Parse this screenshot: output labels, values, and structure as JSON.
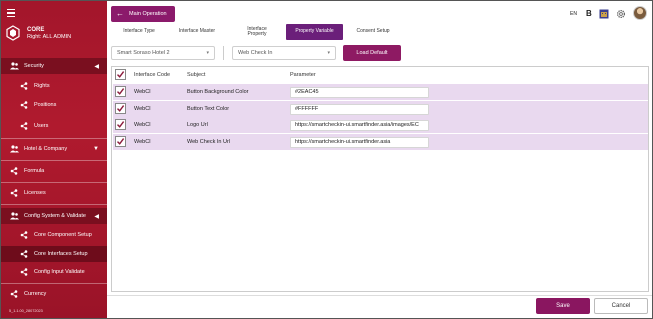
{
  "colors": {
    "sidebar": "#a3162b",
    "accent": "#6b1f7a",
    "row_highlight": "#e9d9ef",
    "button": "#8a1660"
  },
  "brand": {
    "name": "CORE",
    "right": "Right: ALL ADMIN"
  },
  "sidebar": {
    "items": [
      {
        "label": "Security",
        "icon": "people-icon",
        "chevron": "◀"
      },
      {
        "label": "Rights",
        "icon": "share-icon"
      },
      {
        "label": "Positions",
        "icon": "share-icon"
      },
      {
        "label": "Users",
        "icon": "share-icon"
      },
      {
        "label": "Hotel & Company",
        "icon": "people-icon",
        "chevron": "▼"
      },
      {
        "label": "Formula",
        "icon": "share-icon"
      },
      {
        "label": "Licenses",
        "icon": "share-icon"
      },
      {
        "label": "Config System & Validate",
        "icon": "people-icon",
        "chevron": "◀"
      },
      {
        "label": "Core Component Setup",
        "icon": "share-icon"
      },
      {
        "label": "Core Interfaces Setup",
        "icon": "share-icon"
      },
      {
        "label": "Config Input Validate",
        "icon": "share-icon"
      },
      {
        "label": "Currency",
        "icon": "share-icon"
      }
    ],
    "version": "5_1.1.00_28072023"
  },
  "header": {
    "back_label": "Main Operation",
    "lang": "EN",
    "badge": "B"
  },
  "tabs": [
    {
      "label": "Interface Type"
    },
    {
      "label": "Interface Master"
    },
    {
      "label": "Interface Property"
    },
    {
      "label": "Property Variable"
    },
    {
      "label": "Consent Setup"
    }
  ],
  "filters": {
    "hotel": "Smart Soraso Hotel 2",
    "interface": "Web Check In",
    "load_label": "Load Default"
  },
  "table": {
    "headers": {
      "code": "Interface Code",
      "subject": "Subject",
      "parameter": "Parameter"
    },
    "rows": [
      {
        "code": "WebCI",
        "subject": "Button Background Color",
        "parameter": "#2EAC45"
      },
      {
        "code": "WebCI",
        "subject": "Button Text Color",
        "parameter": "#FFFFFF"
      },
      {
        "code": "WebCI",
        "subject": "Logo Url",
        "parameter": "https://smartcheckin-ui.smartfinder.asia/images/EC"
      },
      {
        "code": "WebCI",
        "subject": "Web Check In Url",
        "parameter": "https://smartcheckin-ui.smartfinder.asia"
      }
    ]
  },
  "footer": {
    "save_label": "Save",
    "cancel_label": "Cancel"
  }
}
